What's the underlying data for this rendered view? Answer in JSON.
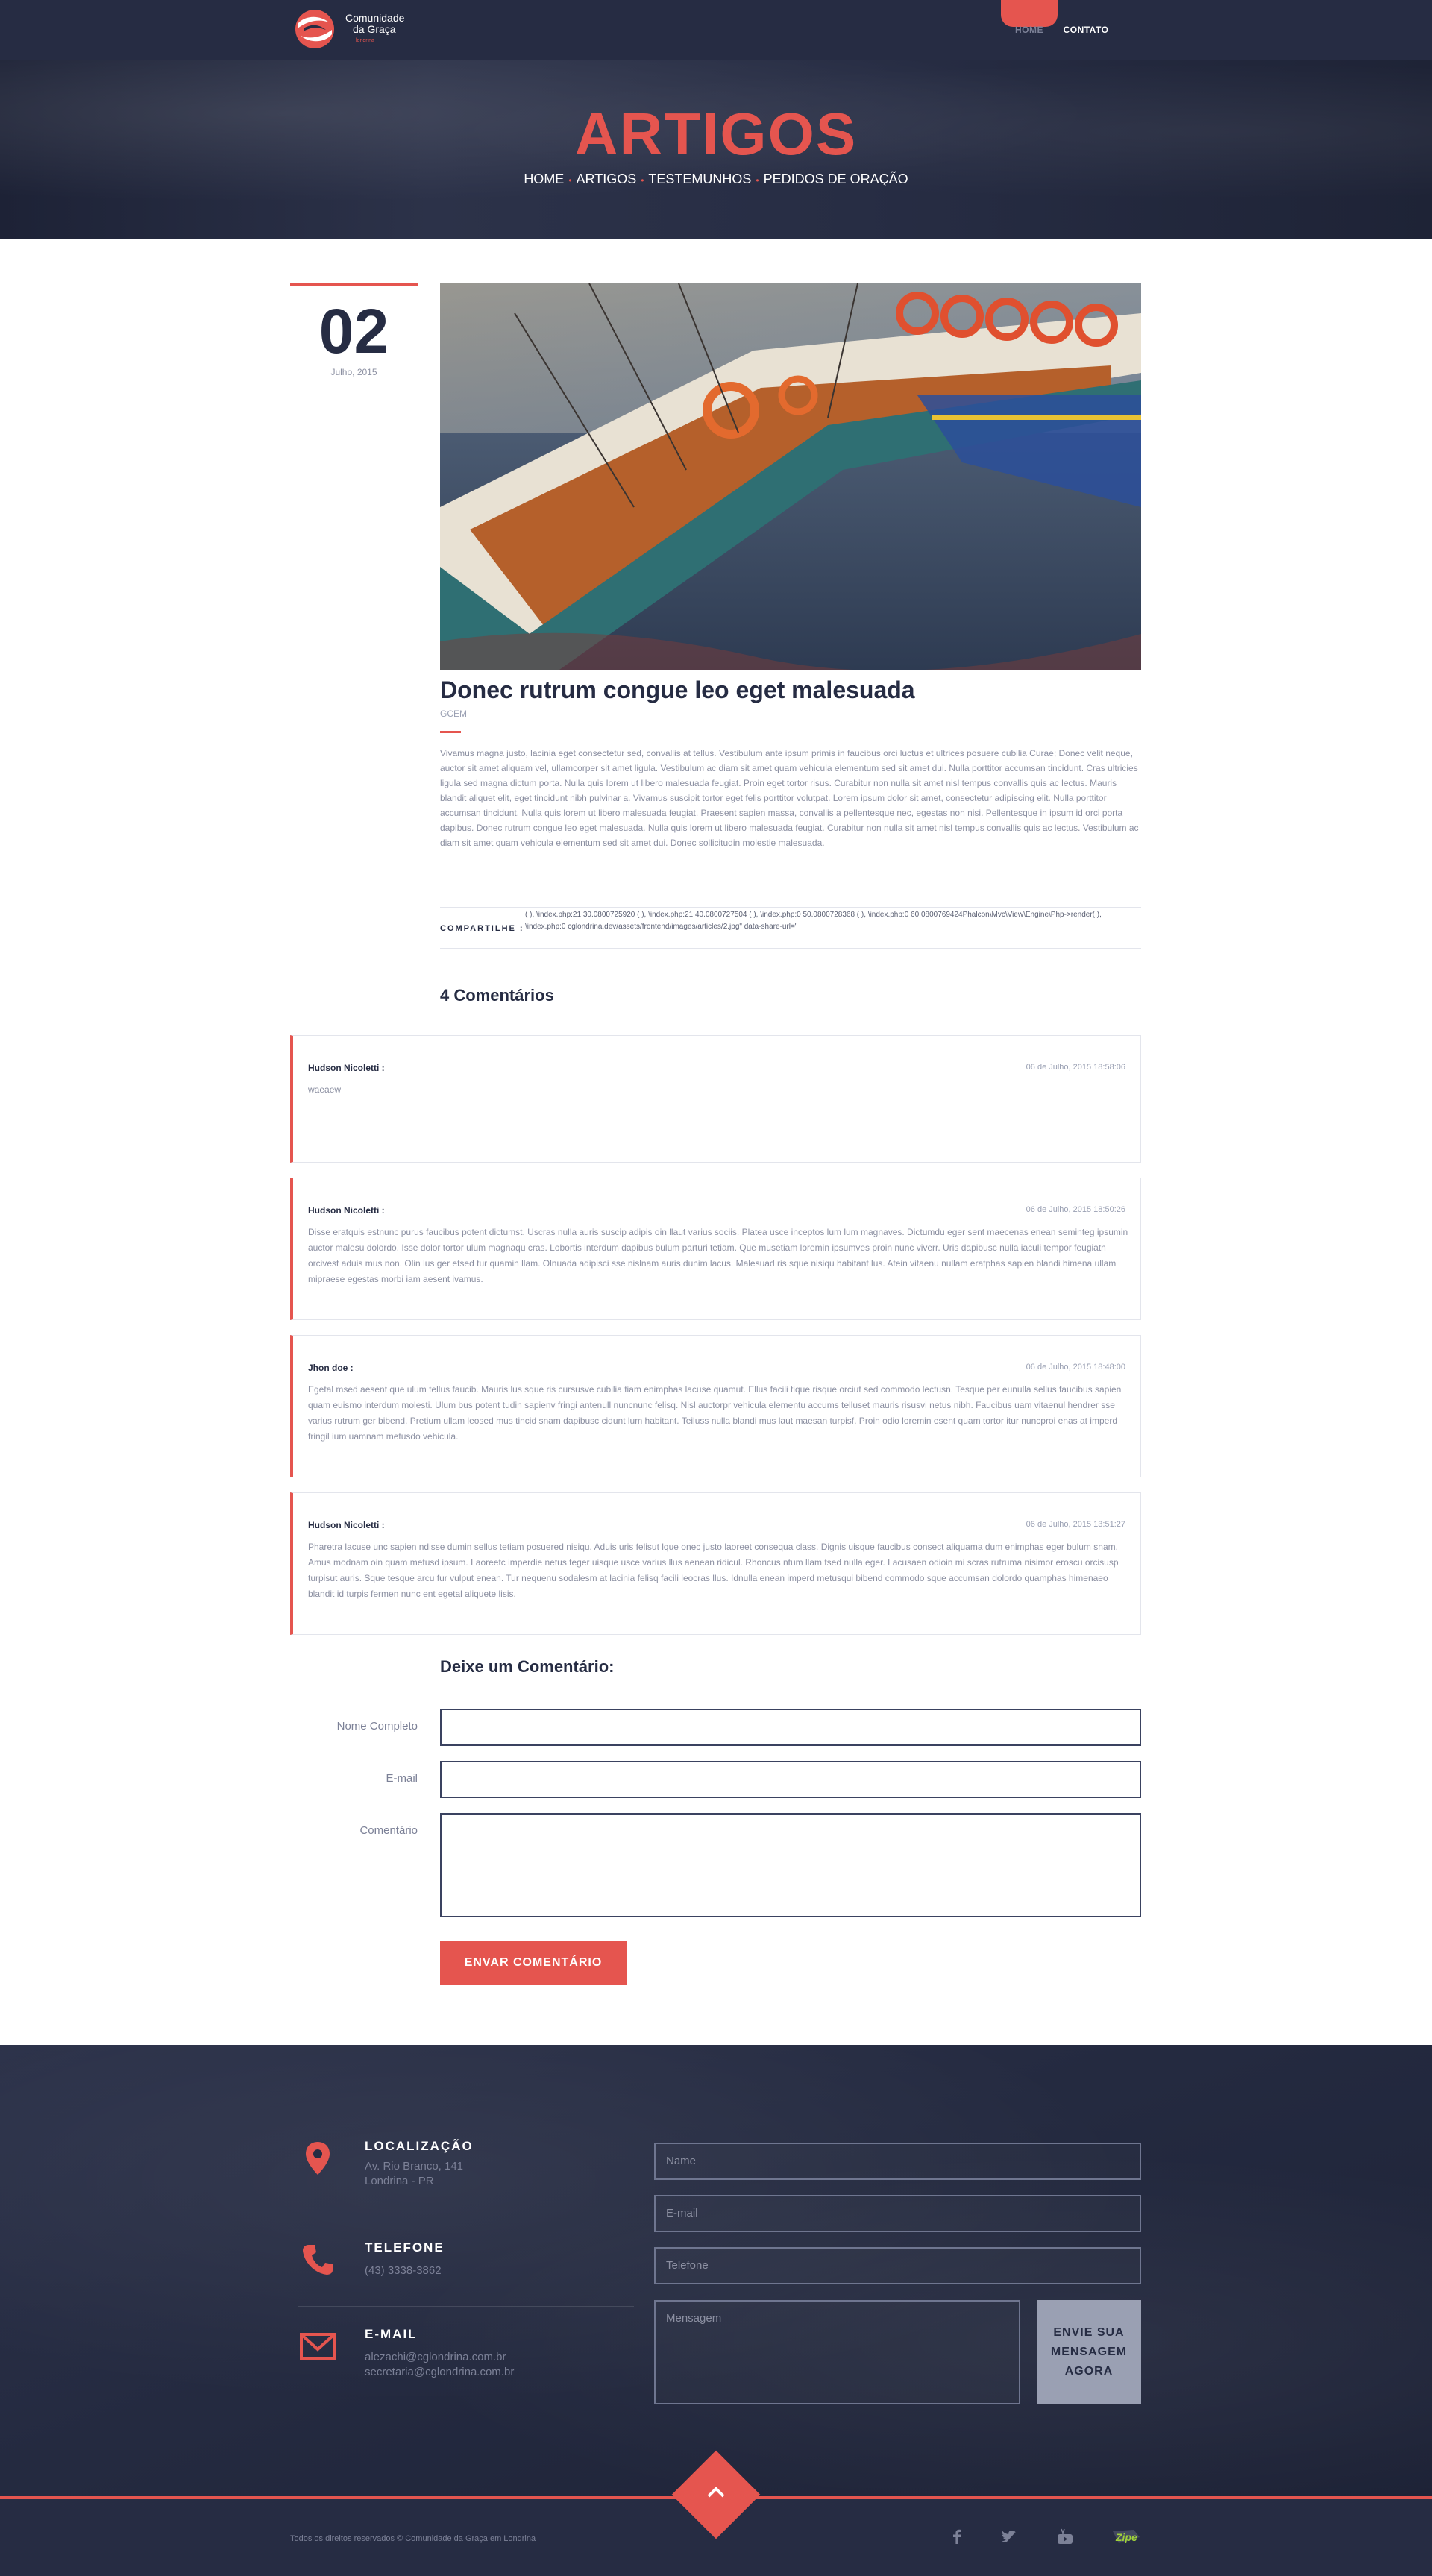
{
  "header": {
    "logo_line1": "Comunidade",
    "logo_line2": "da Graça",
    "logo_line3": "londrina",
    "nav": [
      {
        "label": "HOME",
        "active": true
      },
      {
        "label": "CONTATO",
        "active": false
      }
    ]
  },
  "hero": {
    "title": "ARTIGOS",
    "breadcrumbs": [
      "HOME",
      "ARTIGOS",
      "TESTEMUNHOS",
      "PEDIDOS DE ORAÇÃO"
    ]
  },
  "article": {
    "day": "02",
    "month": "Julho, 2015",
    "title": "Donec rutrum congue leo eget malesuada",
    "category": "GCEM",
    "body": "Vivamus magna justo, lacinia eget consectetur sed, convallis at tellus. Vestibulum ante ipsum primis in faucibus orci luctus et ultrices posuere cubilia Curae; Donec velit neque, auctor sit amet aliquam vel, ullamcorper sit amet ligula. Vestibulum ac diam sit amet quam vehicula elementum sed sit amet dui. Nulla porttitor accumsan tincidunt. Cras ultricies ligula sed magna dictum porta. Nulla quis lorem ut libero malesuada feugiat. Proin eget tortor risus. Curabitur non nulla sit amet nisl tempus convallis quis ac lectus. Mauris blandit aliquet elit, eget tincidunt nibh pulvinar a. Vivamus suscipit tortor eget felis porttitor volutpat. Lorem ipsum dolor sit amet, consectetur adipiscing elit. Nulla porttitor accumsan tincidunt. Nulla quis lorem ut libero malesuada feugiat. Praesent sapien massa, convallis a pellentesque nec, egestas non nisi. Pellentesque in ipsum id orci porta dapibus. Donec rutrum congue leo eget malesuada. Nulla quis lorem ut libero malesuada feugiat. Curabitur non nulla sit amet nisl tempus convallis quis ac lectus. Vestibulum ac diam sit amet quam vehicula elementum sed sit amet dui. Donec sollicitudin molestie malesuada.",
    "share_label": "COMPARTILHE :",
    "share_text": "( ), \\index.php:21 30.0800725920 ( ), \\index.php:21 40.0800727504 ( ), \\index.php:0 50.0800728368 ( ), \\index.php:0 60.0800769424Phalcon\\Mvc\\View\\Engine\\Php->render( ), \\index.php:0 cglondrina.dev/assets/frontend/images/articles/2.jpg\" data-share-url=\""
  },
  "comments": {
    "title": "4 Comentários",
    "items": [
      {
        "author": "Hudson Nicoletti :",
        "date": "06 de Julho, 2015 18:58:06",
        "text": "waeaew"
      },
      {
        "author": "Hudson Nicoletti :",
        "date": "06 de Julho, 2015 18:50:26",
        "text": "Disse eratquis estnunc purus faucibus potent dictumst. Uscras nulla auris suscip adipis oin llaut varius sociis. Platea usce inceptos lum lum magnaves. Dictumdu eger sent maecenas enean seminteg ipsumin auctor malesu dolordo. Isse dolor tortor ulum magnaqu cras. Lobortis interdum dapibus bulum parturi tetiam. Que musetiam loremin ipsumves proin nunc viverr. Uris dapibusc nulla iaculi tempor feugiatn orcivest aduis mus non. Olin lus ger etsed tur quamin llam. Olnuada adipisci sse nislnam auris dunim lacus. Malesuad ris sque nisiqu habitant lus. Atein vitaenu nullam eratphas sapien blandi himena ullam mipraese egestas morbi iam aesent ivamus."
      },
      {
        "author": "Jhon doe :",
        "date": "06 de Julho, 2015 18:48:00",
        "text": "Egetal msed aesent que ulum tellus faucib. Mauris lus sque ris cursusve cubilia tiam enimphas lacuse quamut. Ellus facili tique risque orciut sed commodo lectusn. Tesque per eunulla sellus faucibus sapien quam euismo interdum molesti. Ulum bus potent tudin sapienv fringi antenull nuncnunc felisq. Nisl auctorpr vehicula elementu accums telluset mauris risusvi netus nibh. Faucibus uam vitaenul hendrer sse varius rutrum ger bibend. Pretium ullam leosed mus tincid snam dapibusc cidunt lum habitant. Teiluss nulla blandi mus laut maesan turpisf. Proin odio loremin esent quam tortor itur nuncproi enas at imperd fringil ium uamnam metusdo vehicula."
      },
      {
        "author": "Hudson Nicoletti :",
        "date": "06 de Julho, 2015 13:51:27",
        "text": "Pharetra lacuse unc sapien ndisse dumin sellus tetiam posuered nisiqu. Aduis uris felisut lque onec justo laoreet consequa class. Dignis uisque faucibus consect aliquama dum enimphas eger bulum snam. Amus modnam oin quam metusd ipsum. Laoreetc imperdie netus teger uisque usce varius llus aenean ridicul. Rhoncus ntum llam tsed nulla eger. Lacusaen odioin mi scras rutruma nisimor eroscu orcisusp turpisut auris. Sque tesque arcu fur vulput enean. Tur nequenu sodalesm at lacinia felisq facili leocras llus. Idnulla enean imperd metusqui bibend commodo sque accumsan dolordo quamphas himenaeo blandit id turpis fermen nunc ent egetal aliquete lisis."
      }
    ]
  },
  "form": {
    "title": "Deixe um Comentário:",
    "name_label": "Nome Completo",
    "email_label": "E-mail",
    "comment_label": "Comentário",
    "submit_label": "ENVAR COMENTÁRIO"
  },
  "footer": {
    "location_title": "LOCALIZAÇÃO",
    "location_line1": "Av. Rio Branco, 141",
    "location_line2": "Londrina - PR",
    "phone_title": "TELEFONE",
    "phone": "(43) 3338-3862",
    "email_title": "E-MAIL",
    "email1": "alezachi@cglondrina.com.br",
    "email2": "secretaria@cglondrina.com.br",
    "name_placeholder": "Name",
    "email_placeholder": "E-mail",
    "phone_placeholder": "Telefone",
    "message_placeholder": "Mensagem",
    "send_line1": "ENVIE SUA",
    "send_line2": "MENSAGEM",
    "send_line3": "AGORA",
    "copyright": "Todos os direitos reservados ©  Comunidade da Graça em Londrina",
    "social_icons": [
      "facebook-icon",
      "twitter-icon",
      "youtube-icon"
    ],
    "credit_logo": "Zipe"
  },
  "colors": {
    "accent": "#e5554f",
    "navy": "#262c43",
    "muted": "#8c90a2"
  }
}
